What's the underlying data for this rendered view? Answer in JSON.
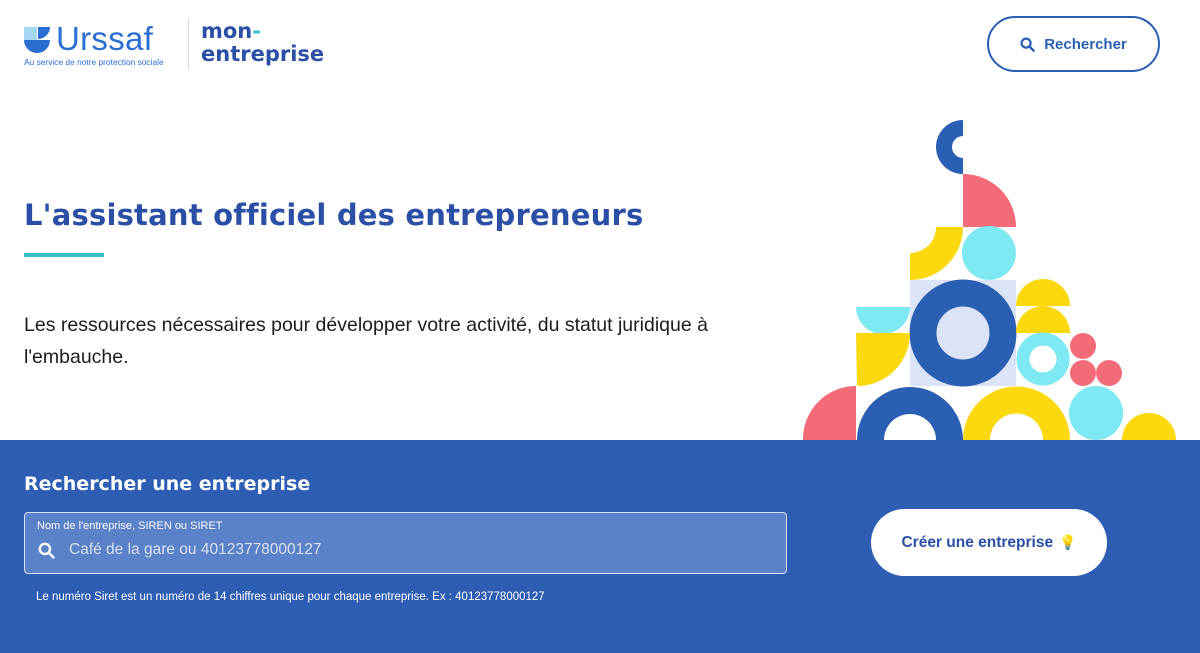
{
  "header": {
    "logo": {
      "wordmark": "Urssaf",
      "tagline": "Au service de notre protection sociale",
      "product_line1": "mon",
      "product_dash": "-",
      "product_line2": "entreprise"
    },
    "search_button_label": "Rechercher"
  },
  "hero": {
    "title": "L'assistant officiel des entrepreneurs",
    "description": "Les ressources nécessaires pour développer votre activité, du statut juridique à l'embauche."
  },
  "search_panel": {
    "title": "Rechercher une entreprise",
    "field_label": "Nom de l'entreprise, SIREN ou SIRET",
    "placeholder": "Café de la gare ou 40123778000127",
    "hint": "Le numéro Siret est un numéro de 14 chiffres unique pour chaque entreprise. Ex : 40123778000127",
    "create_button_label": "Créer une entreprise",
    "create_button_icon": "lightbulb-icon"
  },
  "colors": {
    "brand_blue": "#2b4fa5",
    "panel_blue": "#2e5eb4",
    "accent_teal": "#34c0c9",
    "shape_yellow": "#fcd80f",
    "shape_pink": "#f36a78",
    "shape_cyan": "#7ee9f2",
    "shape_light": "#dbe5f7"
  }
}
